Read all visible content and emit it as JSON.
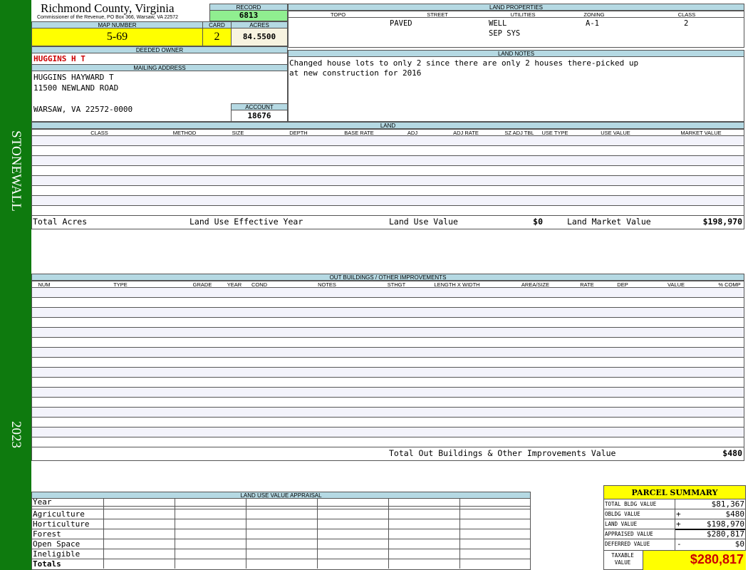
{
  "sidebar": {
    "district": "STONEWALL",
    "year": "2023",
    "color": "#0e7a0e"
  },
  "header": {
    "county": "Richmond County, Virginia",
    "address": "Commissioner of the Revenue, PO Box 366, Warsaw, VA 22572"
  },
  "record": {
    "label": "RECORD",
    "value": "6813"
  },
  "map": {
    "label": "MAP NUMBER",
    "value": "5-69"
  },
  "card": {
    "label": "CARD",
    "value": "2"
  },
  "acres": {
    "label": "ACRES",
    "value": "84.5500"
  },
  "owner": {
    "label": "DEEDED OWNER",
    "value": "HUGGINS H T"
  },
  "mailing": {
    "label": "MAILING ADDRESS",
    "line1": "HUGGINS HAYWARD T",
    "line2": "11500 NEWLAND ROAD",
    "line3": "WARSAW, VA 22572-0000"
  },
  "account": {
    "label": "ACCOUNT",
    "value": "18676"
  },
  "land_properties": {
    "title": "LAND PROPERTIES",
    "headers": [
      "TOPO",
      "STREET",
      "UTILITIES",
      "ZONING",
      "CLASS"
    ],
    "street": "PAVED",
    "utilities1": "WELL",
    "utilities2": "SEP SYS",
    "zoning": "A-1",
    "class": "2"
  },
  "land_notes": {
    "title": "LAND NOTES",
    "line1": "Changed house lots to only 2 since there are only 2 houses there-picked up",
    "line2": "at new construction for 2016"
  },
  "land": {
    "title": "LAND",
    "headers": [
      "CLASS",
      "METHOD",
      "SIZE",
      "DEPTH",
      "BASE RATE",
      "ADJ",
      "ADJ RATE",
      "SZ ADJ TBL",
      "USE TYPE",
      "USE VALUE",
      "MARKET VALUE"
    ],
    "total_acres_label": "Total Acres",
    "effective_year_label": "Land Use Effective Year",
    "use_value_label": "Land Use Value",
    "use_value": "$0",
    "market_value_label": "Land Market Value",
    "market_value": "$198,970"
  },
  "outbuildings": {
    "title": "OUT BUILDINGS / OTHER IMPROVEMENTS",
    "headers": [
      "NUM",
      "TYPE",
      "GRADE",
      "YEAR",
      "COND",
      "NOTES",
      "STHGT",
      "LENGTH X WIDTH",
      "AREA/SIZE",
      "RATE",
      "DEP",
      "VALUE",
      "% COMP"
    ],
    "total_label": "Total Out Buildings & Other Improvements Value",
    "total_value": "$480"
  },
  "land_use_appraisal": {
    "title": "LAND USE VALUE APPRAISAL",
    "rows": [
      "Year",
      "Agriculture",
      "Horticulture",
      "Forest",
      "Open Space",
      "Ineligible",
      "Totals"
    ]
  },
  "parcel_summary": {
    "title": "PARCEL SUMMARY",
    "rows": [
      {
        "label": "TOTAL BLDG VALUE",
        "op": "",
        "value": "$81,367"
      },
      {
        "label": "OBLDG VALUE",
        "op": "+",
        "value": "$480"
      },
      {
        "label": "LAND VALUE",
        "op": "+",
        "value": "$198,970"
      },
      {
        "label": "APPRAISED VALUE",
        "op": "",
        "value": "$280,817"
      },
      {
        "label": "DEFERRED VALUE",
        "op": "-",
        "value": "$0"
      }
    ],
    "taxable_label1": "TAXABLE",
    "taxable_label2": "VALUE",
    "taxable_value": "$280,817"
  },
  "colors": {
    "header_blue": "#b5d9e3",
    "highlight_yellow": "#ffff00",
    "record_green": "#90ee90",
    "owner_red": "#cc0000"
  }
}
